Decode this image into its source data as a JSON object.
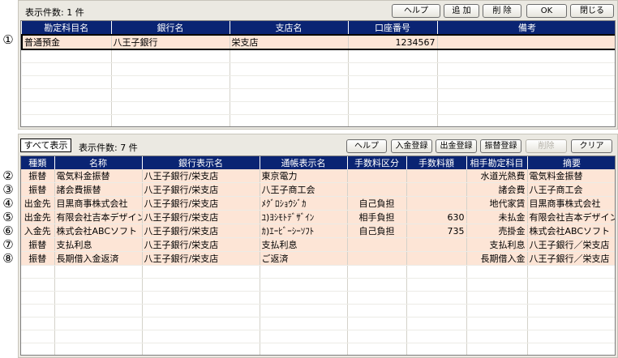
{
  "row_markers": [
    "①",
    "②",
    "③",
    "④",
    "⑤",
    "⑥",
    "⑦",
    "⑧"
  ],
  "top": {
    "count_label": "表示件数: 1 件",
    "buttons": {
      "help": "ヘルプ",
      "add": "追 加",
      "delete": "削 除",
      "ok": "OK",
      "close": "閉じる"
    },
    "columns": [
      "勘定科目名",
      "銀行名",
      "支店名",
      "口座番号",
      "備考"
    ],
    "rows": [
      [
        "普通預金",
        "八王子銀行",
        "栄支店",
        "1234567",
        ""
      ]
    ],
    "empty_rows": 6
  },
  "bottom": {
    "show_all": "すべて表示",
    "count_label": "表示件数: 7 件",
    "buttons": {
      "help": "ヘルプ",
      "deposit": "入金登録",
      "withdraw": "出金登録",
      "transfer": "振替登録",
      "delete": "削除",
      "clear": "クリア"
    },
    "columns": [
      "種類",
      "名称",
      "銀行表示名",
      "通帳表示名",
      "手数料区分",
      "手数料額",
      "相手勘定科目",
      "摘要"
    ],
    "rows": [
      [
        "振替",
        "電気料金振替",
        "八王子銀行/栄支店",
        "東京電力",
        "",
        "",
        "水道光熱費",
        "電気料金振替"
      ],
      [
        "振替",
        "諸会費振替",
        "八王子銀行/栄支店",
        "八王子商工会",
        "",
        "",
        "諸会費",
        "八王子商工会"
      ],
      [
        "出金先",
        "目黒商事株式会社",
        "八王子銀行/栄支店",
        "ﾒｸﾞﾛｼｮｳｼﾞｶ",
        "自己負担",
        "",
        "地代家賃",
        "目黒商事株式会社"
      ],
      [
        "出金先",
        "有限会社吉本デザイン",
        "八王子銀行/栄支店",
        "ﾕ)ﾖｼﾓﾄﾃﾞｻﾞｲﾝ",
        "相手負担",
        "630",
        "未払金",
        "有限会社吉本デザイン"
      ],
      [
        "入金先",
        "株式会社ABCソフト",
        "八王子銀行/栄支店",
        "ｶ)ｴｰﾋﾞｰｼｰｿﾌﾄ",
        "自己負担",
        "735",
        "売掛金",
        "株式会社ABCソフト"
      ],
      [
        "振替",
        "支払利息",
        "八王子銀行/栄支店",
        "支払利息",
        "",
        "",
        "支払利息",
        "八王子銀行／栄支店"
      ],
      [
        "振替",
        "長期借入金返済",
        "八王子銀行/栄支店",
        "ご返済",
        "",
        "",
        "長期借入金",
        "八王子銀行／栄支店"
      ]
    ],
    "empty_rows": 7
  }
}
